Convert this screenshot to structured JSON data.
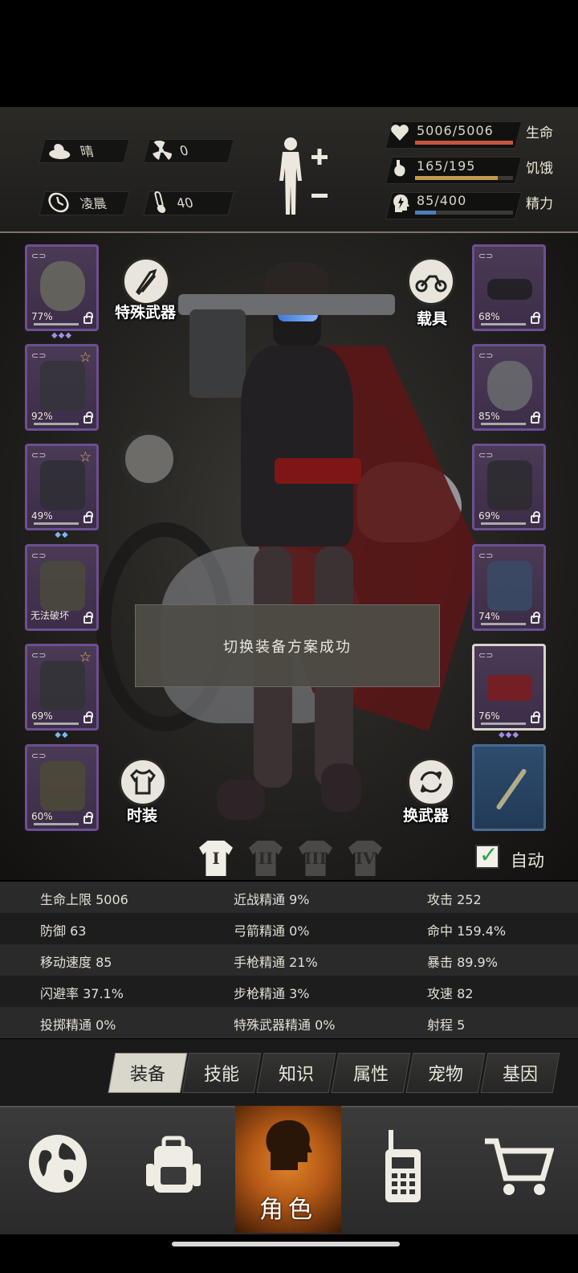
{
  "status": {
    "weather": "晴",
    "radiation": "0",
    "time_of_day": "凌晨",
    "temperature": "40",
    "health": {
      "value": "5006/5006",
      "label": "生命",
      "ratio": 1.0,
      "color": "#c4553f"
    },
    "hunger": {
      "value": "165/195",
      "label": "饥饿",
      "ratio": 0.846,
      "color": "#c49a4f"
    },
    "energy": {
      "value": "85/400",
      "label": "精力",
      "ratio": 0.2125,
      "color": "#4c7fb6"
    }
  },
  "buttons": {
    "special_weapon": "特殊武器",
    "vehicle": "载具",
    "fashion": "时装",
    "swap_weapon": "换武器"
  },
  "slots_left": [
    {
      "pct": "77%",
      "star": false,
      "gems": "◆◆◆"
    },
    {
      "pct": "92%",
      "star": true,
      "gems": ""
    },
    {
      "pct": "49%",
      "star": true,
      "gems": "◆◆"
    },
    {
      "cant_break": "无法破坏"
    },
    {
      "pct": "69%",
      "star": true,
      "gems": "◆◆"
    },
    {
      "pct": "60%",
      "star": false,
      "gems": ""
    }
  ],
  "slots_right": [
    {
      "pct": "68%"
    },
    {
      "pct": "85%"
    },
    {
      "pct": "69%"
    },
    {
      "pct": "74%"
    },
    {
      "pct": "76%",
      "gems": "◆◆◆"
    }
  ],
  "toast": "切换装备方案成功",
  "outfits": [
    "I",
    "II",
    "III",
    "IV"
  ],
  "auto_label": "自动",
  "stats": [
    [
      "生命上限 5006",
      "近战精通 9%",
      "攻击 252"
    ],
    [
      "防御 63",
      "弓箭精通 0%",
      "命中 159.4%"
    ],
    [
      "移动速度 85",
      "手枪精通 21%",
      "暴击 89.9%"
    ],
    [
      "闪避率 37.1%",
      "步枪精通 3%",
      "攻速 82"
    ],
    [
      "投掷精通 0%",
      "特殊武器精通 0%",
      "射程 5"
    ]
  ],
  "tabs": [
    "装备",
    "技能",
    "知识",
    "属性",
    "宠物",
    "基因"
  ],
  "nav": {
    "role_label": "角色"
  },
  "icons": [
    "weather-sun-cloud-icon",
    "radiation-icon",
    "clock-icon",
    "thermometer-icon",
    "heart-icon",
    "stomach-icon",
    "energy-head-icon",
    "body-silhouette-icon",
    "rocket-icon",
    "motorcycle-icon",
    "shirt-icon",
    "swap-icon",
    "globe-icon",
    "backpack-icon",
    "walkie-talkie-icon",
    "shopping-cart-icon"
  ]
}
